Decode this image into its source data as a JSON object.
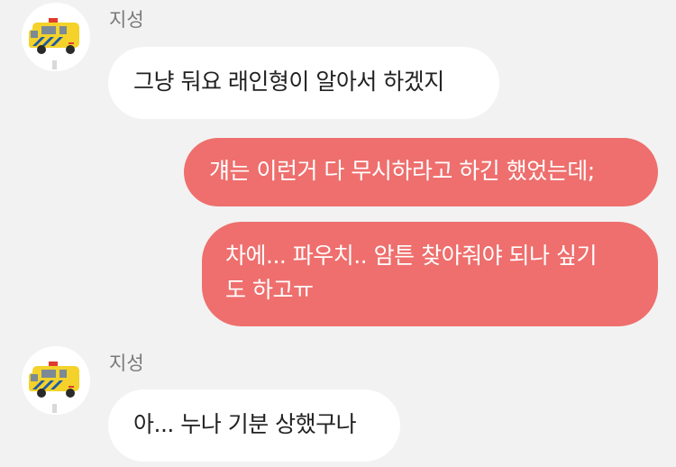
{
  "colors": {
    "background": "#f2f2f2",
    "incoming_bubble": "#ffffff",
    "outgoing_bubble": "#ee6f6d",
    "sender_name": "#7a7a7a",
    "text_dark": "#222222",
    "text_light": "#ffffff"
  },
  "contact": {
    "avatar_icon": "ambulance-avatar-icon"
  },
  "messages": [
    {
      "direction": "incoming",
      "sender": "지성",
      "lines": [
        "그냥 둬요 래인형이 알아서 하겠지"
      ]
    },
    {
      "direction": "outgoing",
      "lines": [
        "걔는 이런거 다 무시하라고 하긴 했었는데;"
      ]
    },
    {
      "direction": "outgoing",
      "lines": [
        "차에... 파우치.. 암튼 찾아줘야 되나 싶기",
        "도 하고ㅠ"
      ]
    },
    {
      "direction": "incoming",
      "sender": "지성",
      "lines": [
        "아... 누나 기분 상했구나"
      ]
    }
  ]
}
